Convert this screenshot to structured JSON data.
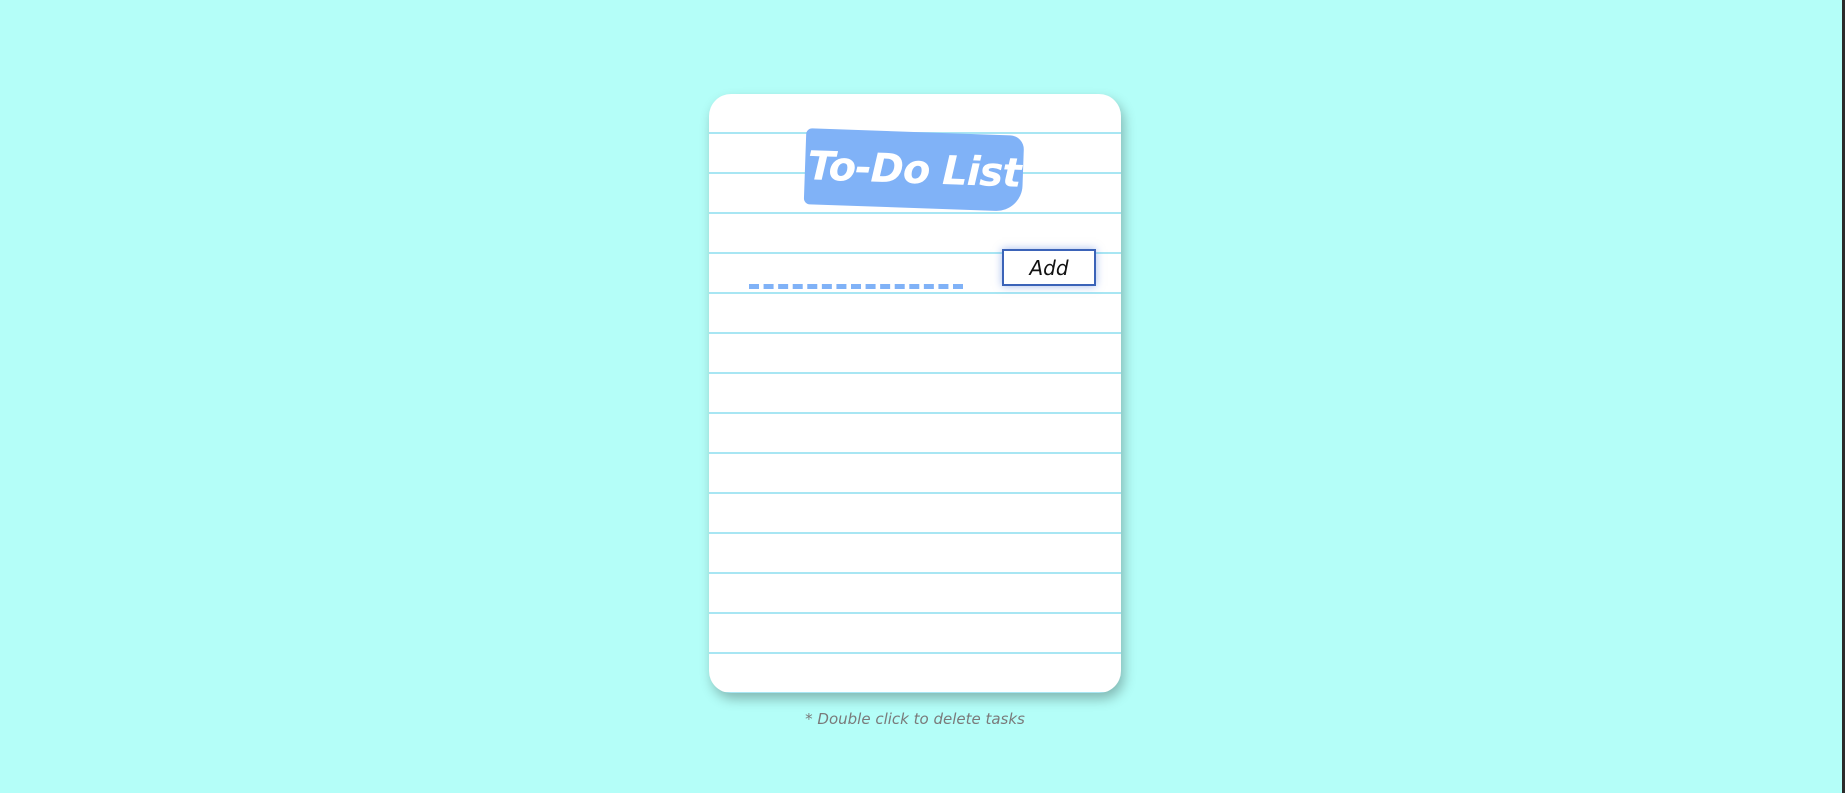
{
  "title": "To-Do List",
  "input": {
    "value": "",
    "placeholder": ""
  },
  "add_button": {
    "label": "Add"
  },
  "tasks": [],
  "hint": "* Double click to delete tasks",
  "colors": {
    "background": "#b4fef8",
    "card": "#ffffff",
    "ruled_line": "#a8e6f3",
    "accent": "#80b2f7",
    "button_border": "#3b63b8",
    "hint_text": "#7a7a7a"
  }
}
